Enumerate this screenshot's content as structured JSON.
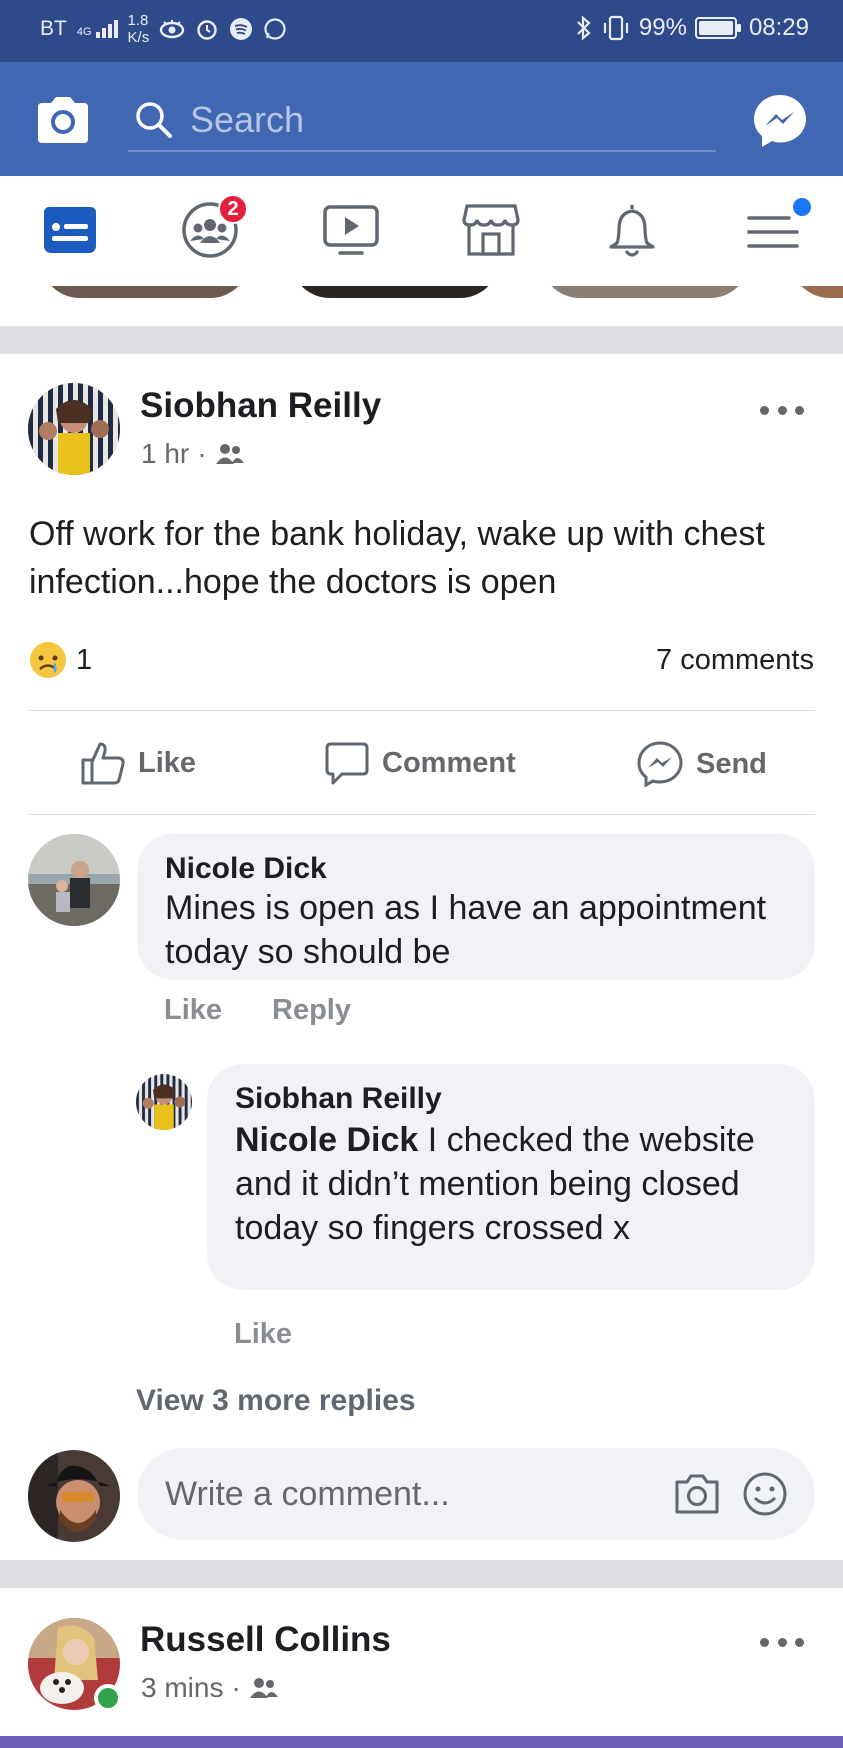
{
  "status_bar": {
    "carrier": "BT",
    "network": "4G",
    "speed_value": "1.8",
    "speed_unit": "K/s",
    "battery_percent": "99%",
    "battery_level": 0.99,
    "time": "08:29"
  },
  "header": {
    "search_placeholder": "Search"
  },
  "nav_tabs": {
    "groups_badge": "2",
    "active_tab": "news-feed"
  },
  "post1": {
    "author": "Siobhan Reilly",
    "time": "1 hr",
    "separator": "·",
    "text": "Off work for the bank holiday, wake up with chest infection...hope the doctors is open",
    "reaction_count": "1",
    "comments_count": "7 comments",
    "actions": {
      "like": "Like",
      "comment": "Comment",
      "send": "Send"
    }
  },
  "comments": [
    {
      "author": "Nicole Dick",
      "text": "Mines is open as I have an appointment today so should be",
      "like": "Like",
      "reply": "Reply"
    }
  ],
  "reply": {
    "author": "Siobhan Reilly",
    "mention": "Nicole Dick",
    "text": " I checked the website and it didn’t mention being closed today so fingers crossed x",
    "like": "Like"
  },
  "view_more_replies": "View 3 more replies",
  "compose": {
    "placeholder": "Write a comment..."
  },
  "post2": {
    "author": "Russell Collins",
    "time": "3 mins",
    "separator": "·"
  },
  "colors": {
    "status_bar": "#2e4a8a",
    "brand_blue": "#4267b2",
    "badge_red": "#e41e3f",
    "notif_dot": "#1877f2",
    "online_green": "#31a24c",
    "bubble_bg": "#f0f2f5",
    "separator_gray": "#dddfe3"
  }
}
